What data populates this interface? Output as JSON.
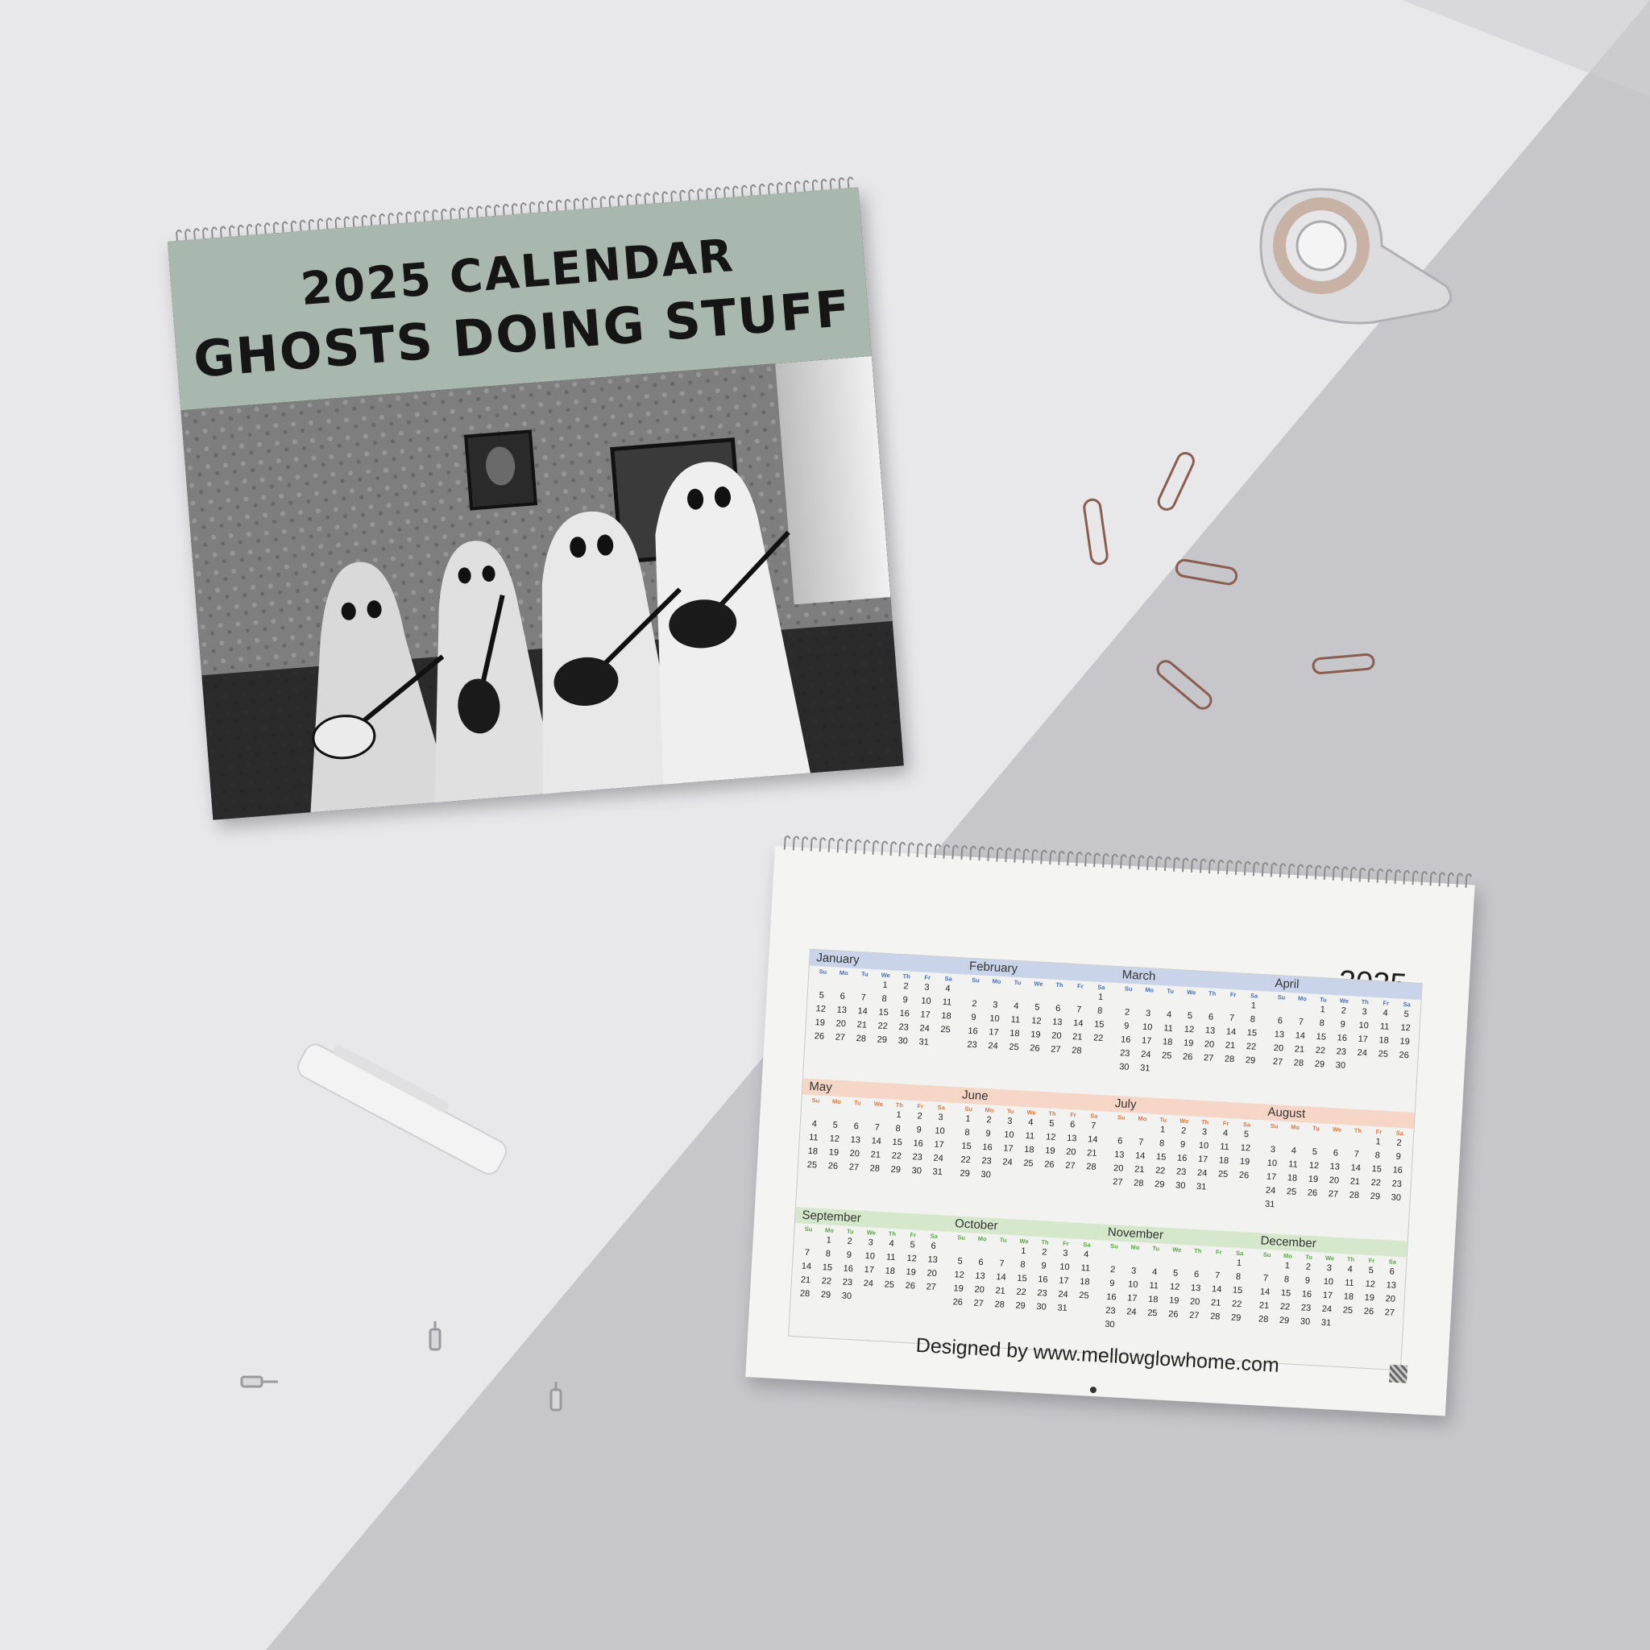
{
  "cover": {
    "title_line1": "2025 CALENDAR",
    "title_line2": "GHOSTS DOING STUFF",
    "photo_subject": "four-ghosts-playing-guitars"
  },
  "back": {
    "year": "2025",
    "designed_by": "Designed by www.mellowglowhome.com",
    "weekdays": [
      "Su",
      "Mo",
      "Tu",
      "We",
      "Th",
      "Fr",
      "Sa"
    ],
    "months": [
      {
        "name": "January",
        "start": 3,
        "length": 31,
        "color": "#c9d4ea",
        "dow_color": "#4a6fb5"
      },
      {
        "name": "February",
        "start": 6,
        "length": 28,
        "color": "#c9d4ea",
        "dow_color": "#4a6fb5"
      },
      {
        "name": "March",
        "start": 6,
        "length": 31,
        "color": "#c9d4ea",
        "dow_color": "#4a6fb5"
      },
      {
        "name": "April",
        "start": 2,
        "length": 30,
        "color": "#c9d4ea",
        "dow_color": "#4a6fb5"
      },
      {
        "name": "May",
        "start": 4,
        "length": 31,
        "color": "#f6d6c6",
        "dow_color": "#e0783c"
      },
      {
        "name": "June",
        "start": 0,
        "length": 30,
        "color": "#f6d6c6",
        "dow_color": "#e0783c"
      },
      {
        "name": "July",
        "start": 2,
        "length": 31,
        "color": "#f6d6c6",
        "dow_color": "#e0783c"
      },
      {
        "name": "August",
        "start": 5,
        "length": 31,
        "color": "#f6d6c6",
        "dow_color": "#e0783c"
      },
      {
        "name": "September",
        "start": 1,
        "length": 30,
        "color": "#d6e8cc",
        "dow_color": "#5aa546"
      },
      {
        "name": "October",
        "start": 3,
        "length": 31,
        "color": "#d6e8cc",
        "dow_color": "#5aa546"
      },
      {
        "name": "November",
        "start": 6,
        "length": 30,
        "color": "#d6e8cc",
        "dow_color": "#5aa546"
      },
      {
        "name": "December",
        "start": 1,
        "length": 31,
        "color": "#d6e8cc",
        "dow_color": "#5aa546"
      }
    ]
  },
  "colors": {
    "background_light": "#e9e9ec",
    "background_shadow": "#c4c4c9",
    "cover_band": "#a9b8ae",
    "paperclip": "#8a5e4e"
  }
}
